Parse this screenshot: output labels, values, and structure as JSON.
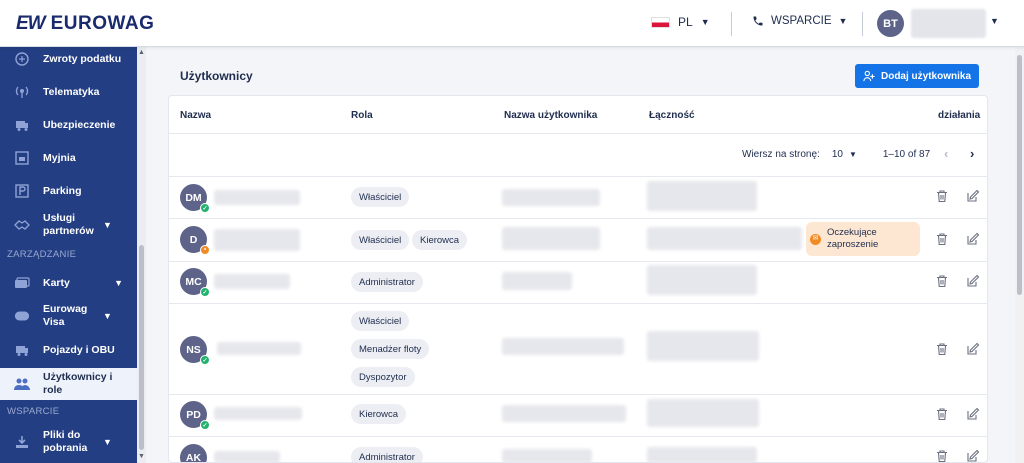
{
  "header": {
    "logo_mark": "EW",
    "logo_text": "EUROWAG",
    "language": "PL",
    "support_label": "WSPARCIE",
    "user_initials": "BT"
  },
  "sidebar": {
    "items": [
      {
        "label": "Zwroty podatku",
        "icon": "tax-refund-icon"
      },
      {
        "label": "Telematyka",
        "icon": "telematics-icon"
      },
      {
        "label": "Ubezpieczenie",
        "icon": "insurance-icon"
      },
      {
        "label": "Myjnia",
        "icon": "car-wash-icon"
      },
      {
        "label": "Parking",
        "icon": "parking-icon"
      },
      {
        "label": "Usługi partnerów",
        "icon": "partner-services-icon"
      },
      {
        "label": "Karty",
        "icon": "cards-icon"
      },
      {
        "label": "Eurowag Visa",
        "icon": "visa-card-icon"
      },
      {
        "label": "Pojazdy i OBU",
        "icon": "vehicle-icon"
      },
      {
        "label": "Użytkownicy i role",
        "icon": "users-icon"
      },
      {
        "label": "Pliki do pobrania",
        "icon": "download-icon"
      }
    ],
    "section_manage": "ZARZĄDZANIE",
    "section_support": "WSPARCIE"
  },
  "main": {
    "title": "Użytkownicy",
    "add_button": "Dodaj użytkownika",
    "columns": {
      "name": "Nazwa",
      "role": "Rola",
      "username": "Nazwa użytkownika",
      "connectivity": "Łączność",
      "actions": "działania"
    },
    "pagination": {
      "rows_per_page_label": "Wiersz na stronę:",
      "rows_per_page_value": "10",
      "range": "1–10 of 87"
    },
    "rows": [
      {
        "initials": "DM",
        "status": "ok",
        "roles": [
          "Właściciel"
        ]
      },
      {
        "initials": "D",
        "status": "pending",
        "roles": [
          "Właściciel",
          "Kierowca"
        ],
        "badge": "Oczekujące zaproszenie"
      },
      {
        "initials": "MC",
        "status": "ok",
        "roles": [
          "Administrator"
        ]
      },
      {
        "initials": "NS",
        "status": "ok",
        "roles": [
          "Właściciel",
          "Menadżer floty",
          "Dyspozytor"
        ]
      },
      {
        "initials": "PD",
        "status": "ok",
        "roles": [
          "Kierowca"
        ]
      },
      {
        "initials": "AK",
        "status": "ok",
        "roles": [
          "Administrator"
        ]
      }
    ]
  },
  "colors": {
    "sidebar_bg": "#233e82",
    "primary_button": "#1473e6",
    "avatar_bg": "#5e6389",
    "status_ok": "#23b26d",
    "status_pending": "#f08a24",
    "invite_bg": "#fde7d2"
  }
}
